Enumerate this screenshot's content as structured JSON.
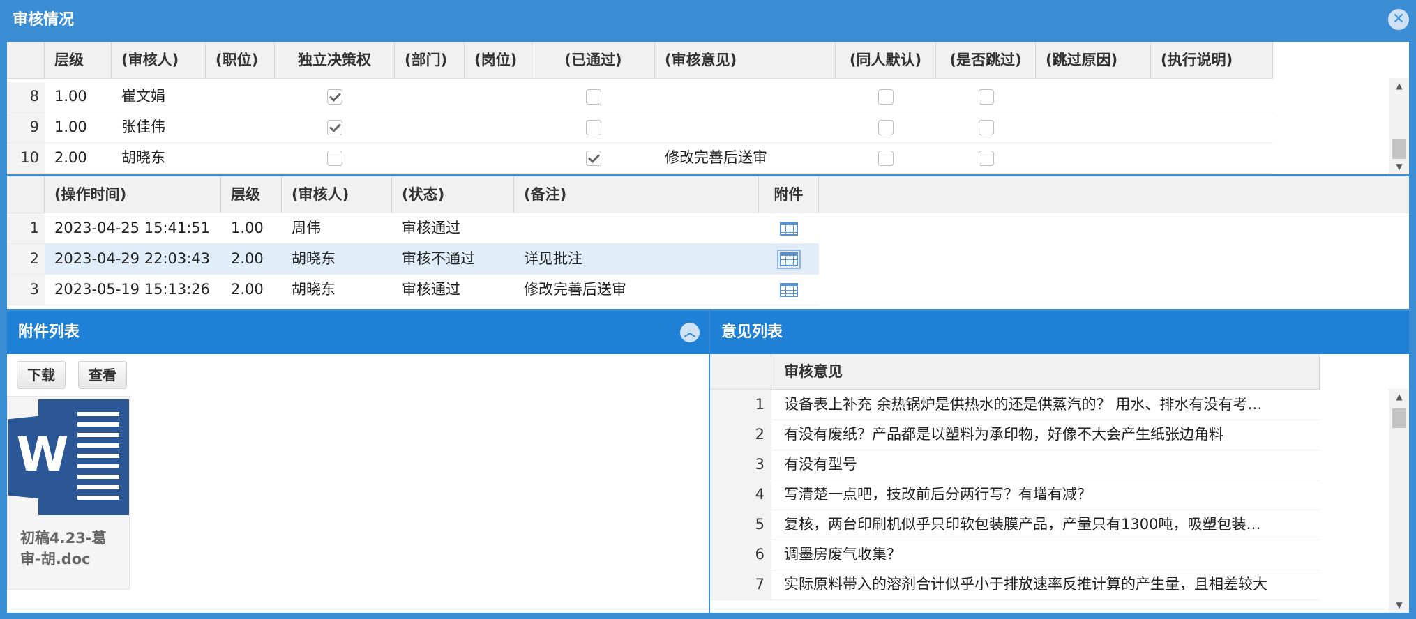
{
  "window": {
    "title": "审核情况",
    "close_glyph": "✕"
  },
  "review_table": {
    "columns": [
      "层级",
      "(审核人)",
      "(职位)",
      "独立决策权",
      "(部门)",
      "(岗位)",
      "(已通过)",
      "(审核意见)",
      "(同人默认)",
      "(是否跳过)",
      "(跳过原因)",
      "(执行说明)"
    ],
    "rows": [
      {
        "num": "8",
        "level": "1.00",
        "reviewer": "崔文娟",
        "independent": true,
        "passed": false,
        "opinion": "",
        "same_default": false,
        "skipped": false
      },
      {
        "num": "9",
        "level": "1.00",
        "reviewer": "张佳伟",
        "independent": true,
        "passed": false,
        "opinion": "",
        "same_default": false,
        "skipped": false
      },
      {
        "num": "10",
        "level": "2.00",
        "reviewer": "胡晓东",
        "independent": false,
        "passed": true,
        "opinion": "修改完善后送审",
        "same_default": false,
        "skipped": false
      }
    ]
  },
  "log_table": {
    "columns": [
      "(操作时间)",
      "层级",
      "(审核人)",
      "(状态)",
      "(备注)",
      "附件"
    ],
    "rows": [
      {
        "num": "1",
        "time": "2023-04-25 15:41:51",
        "level": "1.00",
        "reviewer": "周伟",
        "status": "审核通过",
        "note": ""
      },
      {
        "num": "2",
        "time": "2023-04-29 22:03:43",
        "level": "2.00",
        "reviewer": "胡晓东",
        "status": "审核不通过",
        "note": "详见批注"
      },
      {
        "num": "3",
        "time": "2023-05-19 15:13:26",
        "level": "2.00",
        "reviewer": "胡晓东",
        "status": "审核通过",
        "note": "修改完善后送审"
      }
    ]
  },
  "attachments": {
    "title": "附件列表",
    "download_label": "下载",
    "view_label": "查看",
    "file_name_line1": "初稿4.23-葛",
    "file_name_line2": "审-胡.doc",
    "file_icon_letter": "W"
  },
  "opinions": {
    "title": "意见列表",
    "column": "审核意见",
    "rows": [
      {
        "num": "1",
        "text": "设备表上补充 余热锅炉是供热水的还是供蒸汽的？ 用水、排水有没有考…"
      },
      {
        "num": "2",
        "text": "有没有废纸？产品都是以塑料为承印物，好像不大会产生纸张边角料"
      },
      {
        "num": "3",
        "text": "有没有型号"
      },
      {
        "num": "4",
        "text": "写清楚一点吧，技改前后分两行写？有增有减？"
      },
      {
        "num": "5",
        "text": "复核，两台印刷机似乎只印软包装膜产品，产量只有1300吨，吸塑包装…"
      },
      {
        "num": "6",
        "text": "调墨房废气收集？"
      },
      {
        "num": "7",
        "text": "实际原料带入的溶剂合计似乎小于排放速率反推计算的产生量，且相差较大"
      }
    ]
  },
  "colors": {
    "accent": "#1e81d6",
    "frame": "#3b8ed3",
    "selected_row": "#e1eef9"
  }
}
